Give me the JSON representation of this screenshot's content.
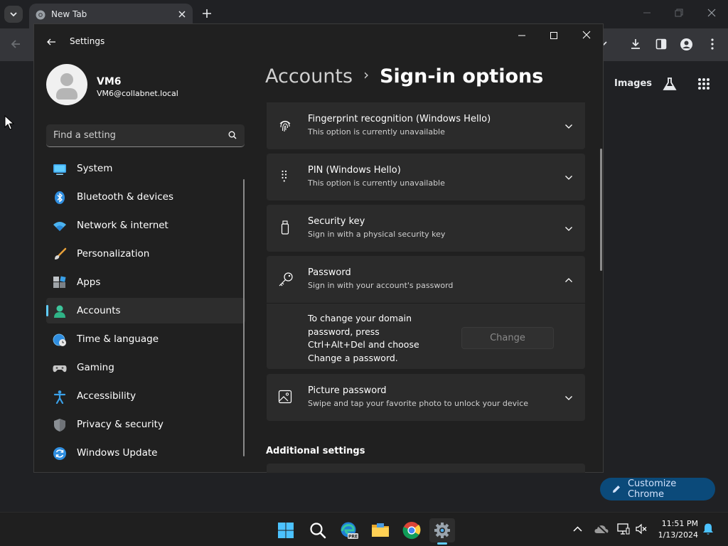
{
  "browser": {
    "tab_title": "New Tab",
    "images_link": "Images",
    "customize_label": "Customize Chrome"
  },
  "settings": {
    "window_title": "Settings",
    "user": {
      "name": "VM6",
      "email": "VM6@collabnet.local"
    },
    "search": {
      "placeholder": "Find a setting"
    },
    "nav": [
      {
        "label": "System",
        "icon": "system-icon"
      },
      {
        "label": "Bluetooth & devices",
        "icon": "bluetooth-icon"
      },
      {
        "label": "Network & internet",
        "icon": "wifi-icon"
      },
      {
        "label": "Personalization",
        "icon": "brush-icon"
      },
      {
        "label": "Apps",
        "icon": "apps-icon"
      },
      {
        "label": "Accounts",
        "icon": "accounts-icon",
        "active": true
      },
      {
        "label": "Time & language",
        "icon": "globe-clock-icon"
      },
      {
        "label": "Gaming",
        "icon": "gamepad-icon"
      },
      {
        "label": "Accessibility",
        "icon": "accessibility-icon"
      },
      {
        "label": "Privacy & security",
        "icon": "shield-icon"
      },
      {
        "label": "Windows Update",
        "icon": "update-icon"
      }
    ],
    "breadcrumb": {
      "parent": "Accounts",
      "separator": "›",
      "current": "Sign-in options"
    },
    "options": [
      {
        "title": "Fingerprint recognition (Windows Hello)",
        "subtitle": "This option is currently unavailable",
        "icon": "fingerprint-icon",
        "expanded": false
      },
      {
        "title": "PIN (Windows Hello)",
        "subtitle": "This option is currently unavailable",
        "icon": "pin-keypad-icon",
        "expanded": false
      },
      {
        "title": "Security key",
        "subtitle": "Sign in with a physical security key",
        "icon": "usb-key-icon",
        "expanded": false
      },
      {
        "title": "Password",
        "subtitle": "Sign in with your account's password",
        "icon": "key-icon",
        "expanded": true
      },
      {
        "title": "Picture password",
        "subtitle": "Swipe and tap your favorite photo to unlock your device",
        "icon": "picture-icon",
        "expanded": false
      }
    ],
    "password_panel": {
      "text": "To change your domain password, press Ctrl+Alt+Del and choose Change a password.",
      "button": "Change"
    },
    "additional_heading": "Additional settings"
  },
  "taskbar": {
    "time": "11:51 PM",
    "date": "1/13/2024",
    "apps": [
      "windows-start-icon",
      "search-icon",
      "edge-pre-icon",
      "file-explorer-icon",
      "chrome-icon",
      "settings-gear-icon"
    ],
    "active_app": "settings-gear-icon"
  },
  "colors": {
    "accent": "#60cdff",
    "window_bg": "#202020",
    "card_bg": "#2b2b2b",
    "chrome_button": "#0b4a7a"
  }
}
